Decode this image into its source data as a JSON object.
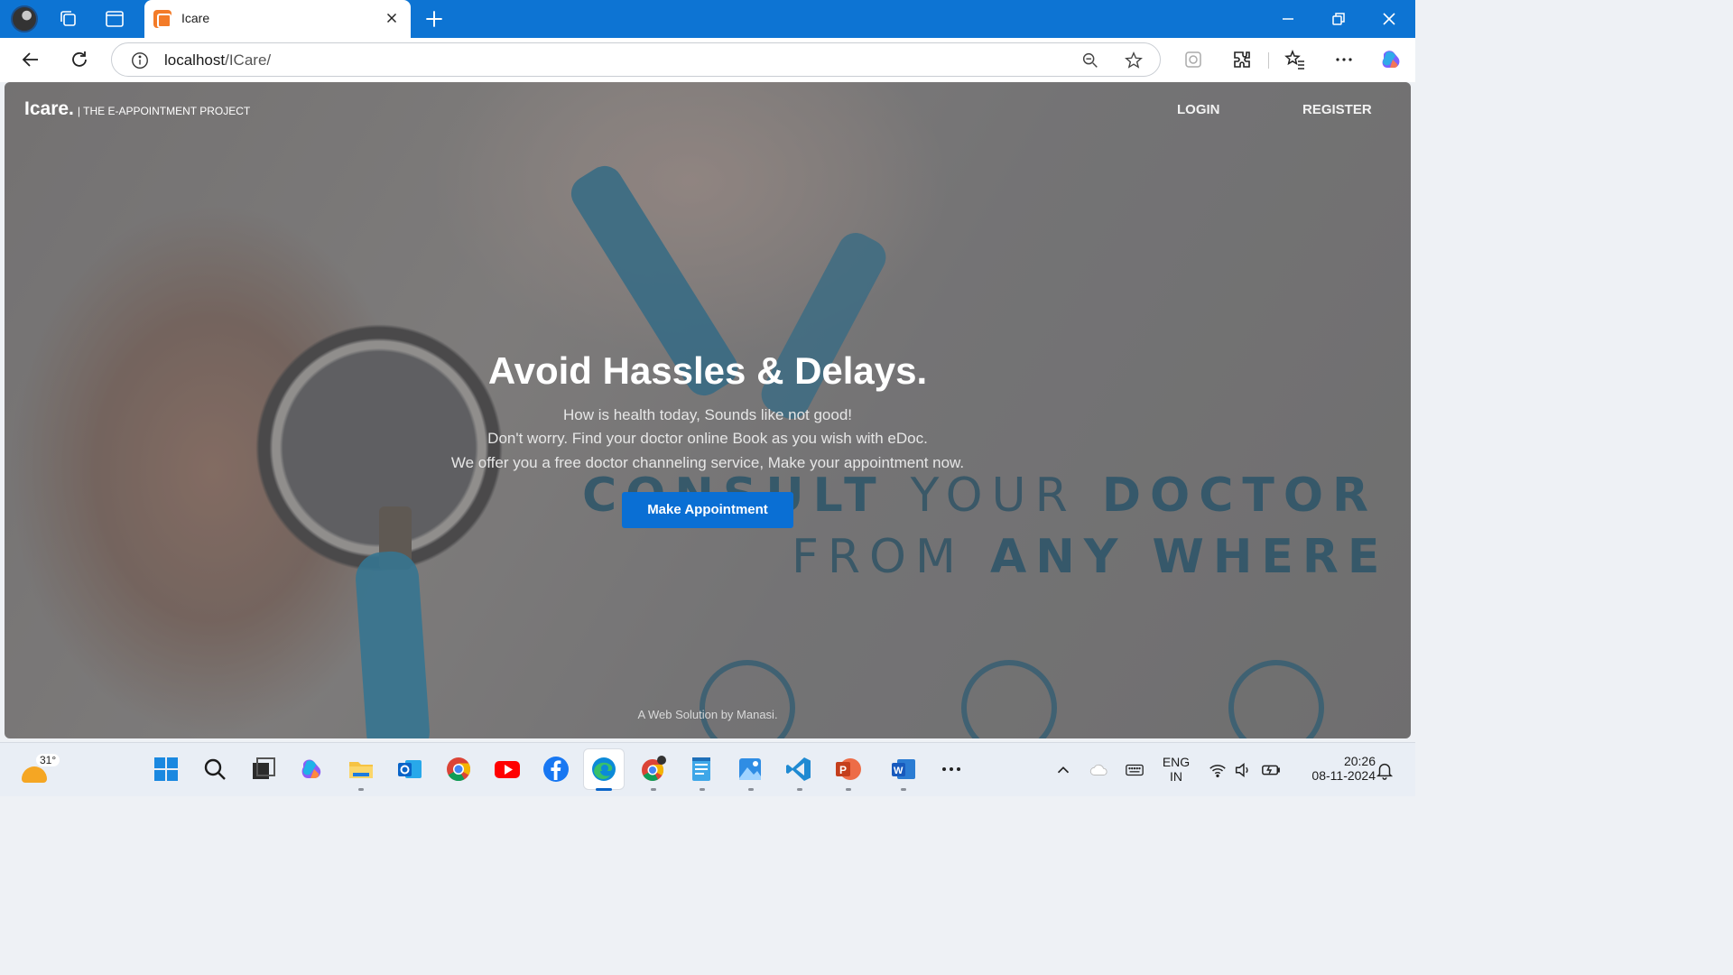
{
  "browser": {
    "tab_title": "Icare",
    "url_host": "localhost",
    "url_path": "/ICare/"
  },
  "page": {
    "brand_name": "Icare.",
    "brand_tagline": "| THE E-APPOINTMENT PROJECT",
    "nav": {
      "login": "LOGIN",
      "register": "REGISTER"
    },
    "hero": {
      "title": "Avoid Hassles & Delays.",
      "lines": [
        "How is health today, Sounds like not good!",
        "Don't worry. Find your doctor online Book as you wish with eDoc.",
        "We offer you a free doctor channeling service, Make your appointment now."
      ],
      "cta_label": "Make Appointment"
    },
    "background_text": {
      "line1_bold": "CONSULT",
      "line1_light": "YOUR",
      "line1_bold2": "DOCTOR",
      "line2_light": "FROM",
      "line2_bold": "ANY WHERE"
    },
    "footer_credit": "A Web Solution by Manasi."
  },
  "taskbar": {
    "weather_temp": "31°",
    "language": "ENG",
    "region": "IN",
    "time": "20:26",
    "date": "08-11-2024"
  },
  "colors": {
    "titlebar": "#0d74d3",
    "cta": "#0a6fd4",
    "background_text": "#1f5d79"
  }
}
